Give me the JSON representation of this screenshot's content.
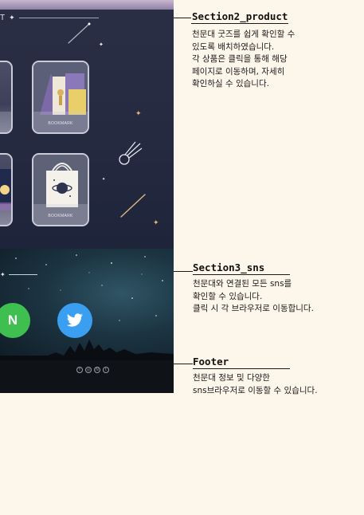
{
  "section2": {
    "title": "T",
    "product_cards": [
      {
        "label": "BOOKMARK"
      },
      {
        "label": "BOOKMARK"
      }
    ]
  },
  "annotations": [
    {
      "title": "Section2_product",
      "description": "천문대 굿즈를 쉽게 확인할 수\n있도록 배치하였습니다.\n각 상품은 클릭을 통해 해당\n페이지로 이동하며, 자세히\n확인하실 수 있습니다."
    },
    {
      "title": "Section3_sns",
      "description": "천문대와 연결된 모든 sns를\n확인할 수 있습니다.\n클릭 시 각 브라우저로 이동합니다."
    },
    {
      "title": "Footer",
      "description": "천문대 정보 및 다양한\nsns브라우저로 이동할 수 있습니다."
    }
  ],
  "sns": {
    "naver_letter": "N",
    "icons": [
      "naver-icon",
      "twitter-icon"
    ]
  },
  "footer": {
    "icons": [
      "facebook-icon",
      "instagram-icon",
      "naver-icon",
      "twitter-icon"
    ]
  },
  "colors": {
    "background": "#fdf6ea",
    "night_sky": "#252a41",
    "naver_green": "#3fbf4f",
    "twitter_blue": "#3a9ff0"
  }
}
